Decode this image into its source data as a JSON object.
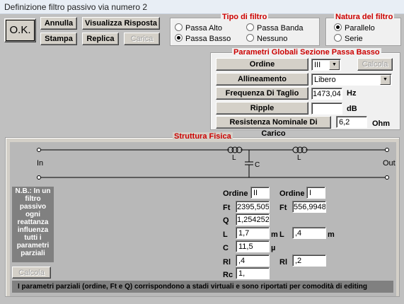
{
  "window": {
    "title": "Definizione filtro passivo via numero 2"
  },
  "buttons": {
    "ok": "O.K.",
    "annulla": "Annulla",
    "visualizza": "Visualizza Risposta",
    "stampa": "Stampa",
    "replica": "Replica",
    "carica": "Carica"
  },
  "tipo_filtro": {
    "legend": "Tipo di filtro",
    "options": [
      "Passa Alto",
      "Passa Banda",
      "Passa Basso",
      "Nessuno"
    ],
    "selected": "Passa Basso"
  },
  "natura_filtro": {
    "legend": "Natura del filtro",
    "options": [
      "Parallelo",
      "Serie"
    ],
    "selected": "Parallelo"
  },
  "parametri_globali": {
    "legend": "Parametri Globali Sezione Passa Basso",
    "ordine_label": "Ordine",
    "ordine_value": "III",
    "calcola": "Calcola",
    "allineamento_label": "Allineamento",
    "allineamento_value": "Libero",
    "frequenza_label": "Frequenza Di Taglio",
    "frequenza_value": "1473,04",
    "frequenza_unit": "Hz",
    "ripple_label": "Ripple",
    "ripple_value": "",
    "ripple_unit": "dB",
    "resistenza_label": "Resistenza Nominale Di Carico",
    "resistenza_value": "6,2",
    "resistenza_unit": "Ohm"
  },
  "struttura": {
    "legend": "Struttura Fisica",
    "in_label": "In",
    "out_label": "Out",
    "l1_label": "L",
    "l2_label": "L",
    "c_label": "C",
    "note": "N.B.: In un filtro passivo ogni reattanza influenza tutti i parametri parziali",
    "calcola": "Calcola",
    "col1": {
      "ordine_label": "Ordine",
      "ordine": "II",
      "ft_label": "Ft",
      "ft": "2395,505",
      "q_label": "Q",
      "q": "1,254252",
      "l_label": "L",
      "l": "1,7",
      "l_unit": "m",
      "c_label": "C",
      "c": "11,5",
      "c_unit": "µ",
      "rl_label": "Rl",
      "rl": ",4",
      "rc_label": "Rc",
      "rc": "1,"
    },
    "col2": {
      "ordine_label": "Ordine",
      "ordine": "I",
      "ft_label": "Ft",
      "ft": "556,9948",
      "l_label": "L",
      "l": ",4",
      "l_unit": "m",
      "rl_label": "Rl",
      "rl": ",2"
    },
    "footer": "I parametri parziali (ordine, Ft e Q) corrispondono a stadi virtuali e sono riportati per comodità di editing"
  },
  "colors": {
    "legend": "#cc0000",
    "client": "#c0c0c0",
    "panel": "#f0f0f0"
  }
}
